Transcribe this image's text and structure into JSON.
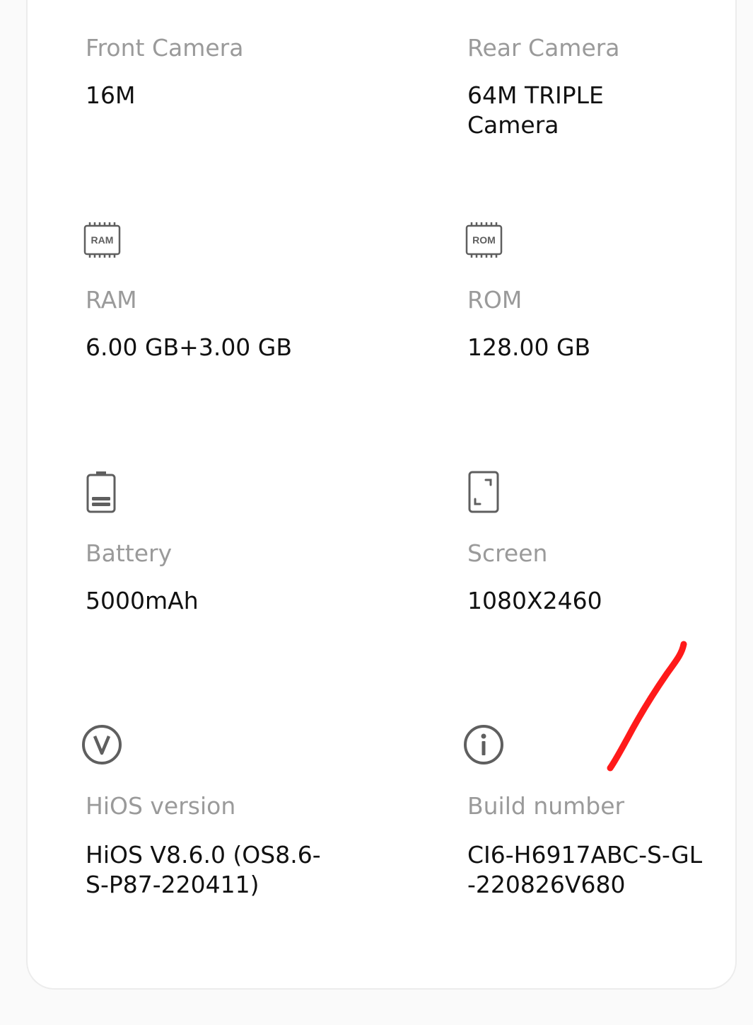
{
  "specs": {
    "front_camera": {
      "label": "Front Camera",
      "value": "16M"
    },
    "rear_camera": {
      "label": "Rear Camera",
      "value": "64M TRIPLE\nCamera"
    },
    "ram": {
      "label": "RAM",
      "value": "6.00 GB+3.00 GB",
      "icon_text": "RAM"
    },
    "rom": {
      "label": "ROM",
      "value": "128.00 GB",
      "icon_text": "ROM"
    },
    "battery": {
      "label": "Battery",
      "value": "5000mAh"
    },
    "screen": {
      "label": "Screen",
      "value": "1080X2460"
    },
    "hios_version": {
      "label": "HiOS version",
      "value": "HiOS V8.6.0 (OS8.6-\nS-P87-220411)"
    },
    "build_number": {
      "label": "Build number",
      "value": "CI6-H6917ABC-S-GL\n-220826V680"
    }
  },
  "colors": {
    "icon": "#5f5f5f",
    "label": "#9a9a9a",
    "value": "#111111",
    "annotation": "#ff1a1a"
  },
  "icons": {
    "ram": "ram-chip-icon",
    "rom": "rom-chip-icon",
    "battery": "battery-icon",
    "screen": "screen-icon",
    "hios_version": "version-icon",
    "build_number": "info-icon"
  }
}
